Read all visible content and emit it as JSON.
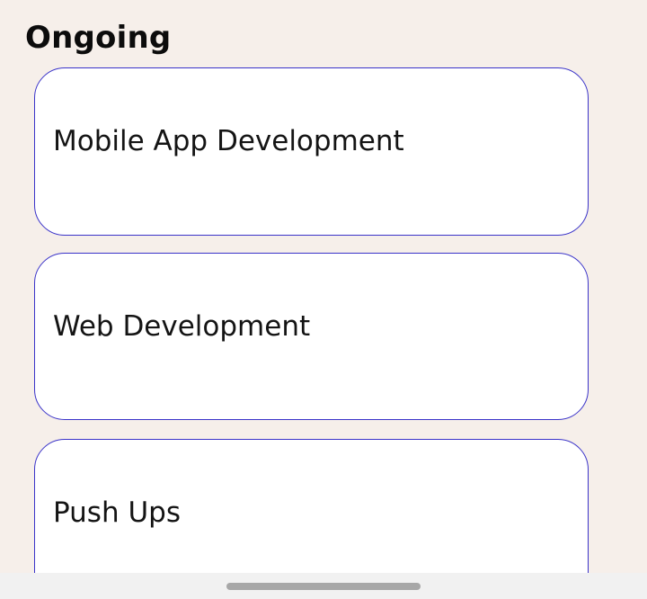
{
  "section": {
    "title": "Ongoing"
  },
  "cards": [
    {
      "title": "Mobile App Development"
    },
    {
      "title": "Web Development"
    },
    {
      "title": "Push Ups"
    }
  ],
  "colors": {
    "background": "#f6efea",
    "card_border": "#3a33c9",
    "card_background": "#ffffff",
    "nav_handle": "#a7a7a7"
  }
}
